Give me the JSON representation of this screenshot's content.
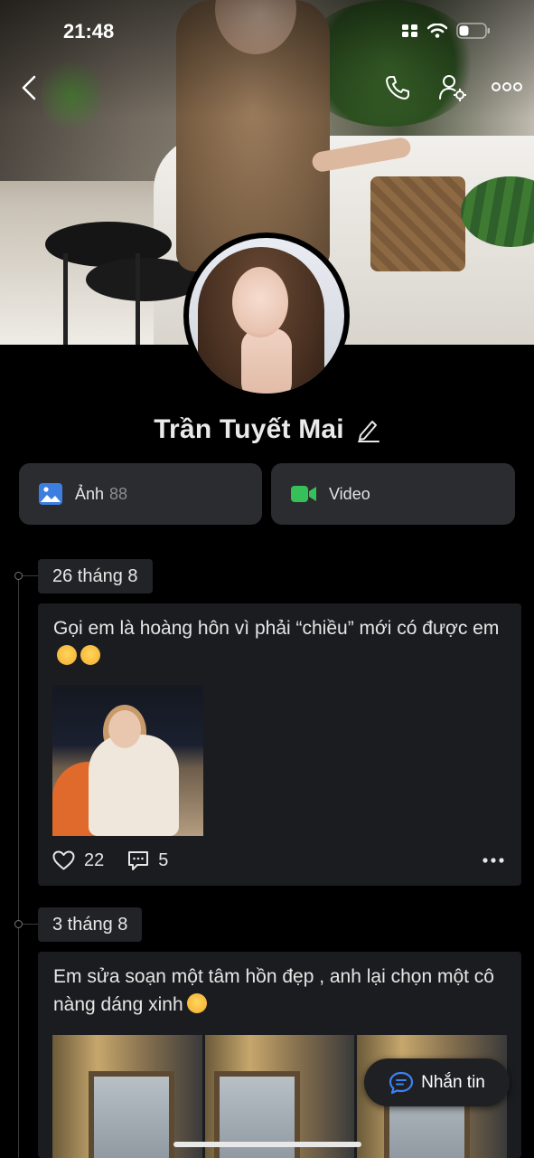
{
  "status_bar": {
    "time": "21:48"
  },
  "profile": {
    "name": "Trần Tuyết Mai"
  },
  "media": {
    "photos_label": "Ảnh",
    "photos_count": "88",
    "videos_label": "Video"
  },
  "posts": [
    {
      "date": "26 tháng 8",
      "text": "Gọi em là hoàng hôn vì phải “chiều” mới có được em",
      "likes": "22",
      "comments": "5"
    },
    {
      "date": "3 tháng 8",
      "text": "Em sửa soạn một tâm hồn đẹp , anh lại chọn một cô nàng dáng xinh"
    }
  ],
  "message_button": {
    "label": "Nhắn tin"
  },
  "colors": {
    "background": "#000000",
    "card": "#1b1c1f",
    "photo_icon": "#3d7fe0",
    "video_icon": "#35c05a",
    "message_icon": "#3b82f6"
  }
}
